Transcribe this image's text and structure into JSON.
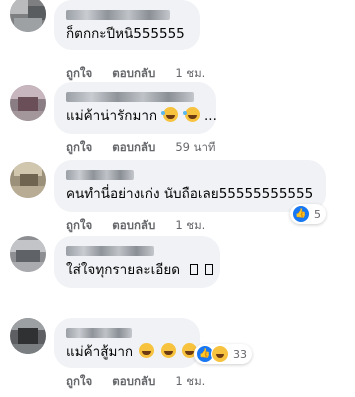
{
  "comments": [
    {
      "text": "ก็ตกกะปีหนิ555555",
      "actions": {
        "like": "ถูกใจ",
        "reply": "ตอบกลับ",
        "time": "1 ชม."
      }
    },
    {
      "text": "แม่ค้าน่ารักมาก",
      "suffix": "...",
      "emojis": [
        "rolling-laughing-emoji",
        "rolling-laughing-emoji"
      ],
      "actions": {
        "like": "ถูกใจ",
        "reply": "ตอบกลับ",
        "time": "59 นาที"
      }
    },
    {
      "text": "คนทำนี่อย่างเก่ง นับถือเลย55555555555",
      "actions": {
        "like": "ถูกใจ",
        "reply": "ตอบกลับ",
        "time": "1 ชม."
      },
      "reactions": {
        "icons": [
          "like-icon",
          "haha-icon"
        ],
        "count": "5"
      }
    },
    {
      "text": "ใส่ใจทุกรายละเอียด",
      "glyphs": [
        "missing-glyph-box",
        "missing-glyph-box"
      ]
    },
    {
      "text": "แม่ค้าสู้มาก",
      "emojis": [
        "grinning-emoji",
        "grinning-emoji",
        "grinning-emoji"
      ],
      "actions": {
        "like": "ถูกใจ",
        "reply": "ตอบกลับ",
        "time": "1 ชม."
      },
      "reactions": {
        "icons": [
          "like-icon",
          "haha-icon"
        ],
        "count": "33"
      }
    }
  ],
  "colors": {
    "bubble": "#f0f2f5",
    "text": "#050505",
    "meta": "#65676b",
    "like_blue": "#1877f2",
    "emoji_yellow": "#f7c23e"
  }
}
